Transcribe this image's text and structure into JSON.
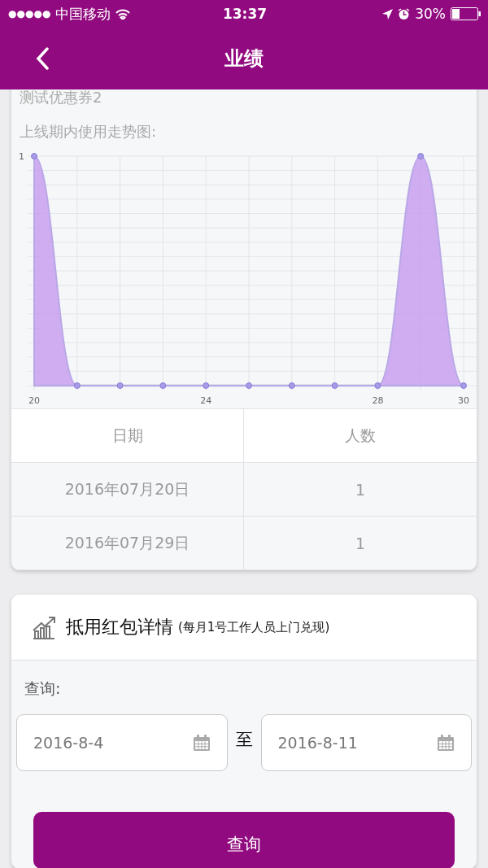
{
  "status_bar": {
    "signal_dots": "●●●●●",
    "carrier": "中国移动",
    "time": "13:37",
    "battery": "30%"
  },
  "nav": {
    "title": "业绩"
  },
  "coupon": {
    "name": "测试优惠券2",
    "chart_label": "上线期内使用走势图:",
    "chart_data": {
      "type": "area",
      "x": [
        20,
        21,
        22,
        23,
        24,
        25,
        26,
        27,
        28,
        29,
        30
      ],
      "series": [
        {
          "color": "#c8a0ee",
          "values": [
            1,
            0,
            0,
            0,
            0,
            0,
            0,
            0,
            0,
            1,
            0
          ]
        }
      ],
      "xlim": [
        20,
        30
      ],
      "ylim": [
        0,
        1
      ],
      "xticks": [
        20,
        24,
        28,
        30
      ],
      "yticks": [
        1
      ]
    },
    "table": {
      "columns": [
        "日期",
        "人数"
      ],
      "rows": [
        [
          "2016年07月20日",
          "1"
        ],
        [
          "2016年07月29日",
          "1"
        ]
      ]
    }
  },
  "redeem": {
    "title": "抵用红包详情",
    "note": "(每月1号工作人员上门兑现)",
    "query_label": "查询:",
    "start_date": "2016-8-4",
    "separator": "至",
    "end_date": "2016-8-11",
    "button": "查询"
  }
}
